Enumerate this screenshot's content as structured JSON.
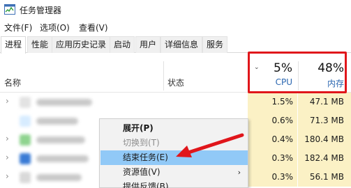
{
  "window": {
    "title": "任务管理器",
    "icon": "task-manager-icon"
  },
  "menu": [
    "文件(F)",
    "选项(O)",
    "查看(V)"
  ],
  "tabs": [
    {
      "label": "进程",
      "active": true
    },
    {
      "label": "性能",
      "active": false
    },
    {
      "label": "应用历史记录",
      "active": false
    },
    {
      "label": "启动",
      "active": false
    },
    {
      "label": "用户",
      "active": false
    },
    {
      "label": "详细信息",
      "active": false
    },
    {
      "label": "服务",
      "active": false
    }
  ],
  "columns": {
    "name": "名称",
    "status": "状态",
    "sort_icon": "chevron-down-icon",
    "cpu": {
      "percent": "5%",
      "label": "CPU"
    },
    "memory": {
      "percent": "48%",
      "label": "内存"
    }
  },
  "rows": [
    {
      "cpu": "1.5%",
      "memory": "47.1 MB",
      "expandable": true,
      "icon_color": "#e3e3e3"
    },
    {
      "cpu": "0.6%",
      "memory": "71.3 MB",
      "expandable": false,
      "icon_color": "#d7ecff"
    },
    {
      "cpu": "0.4%",
      "memory": "180.4 MB",
      "expandable": true,
      "icon_color": "#8fd48f"
    },
    {
      "cpu": "0.3%",
      "memory": "182.4 MB",
      "expandable": true,
      "icon_color": "#3a7bd5"
    },
    {
      "cpu": "0.3%",
      "memory": "56.1 MB",
      "expandable": true,
      "icon_color": "#d9d9d9"
    }
  ],
  "context_menu": [
    {
      "label": "展开(P)",
      "style": "bold"
    },
    {
      "label": "切换到(T)",
      "style": "disabled"
    },
    {
      "label": "结束任务(E)",
      "style": "highlight"
    },
    {
      "label": "资源值(V)",
      "style": "normal",
      "submenu": "›"
    },
    {
      "label": "提供反馈(B)",
      "style": "normal"
    }
  ],
  "colors": {
    "highlight_box": "#e0161b",
    "arrow": "#e0161b",
    "cell_bg": "#fbf1c5",
    "menu_highlight": "#91c9f7",
    "header_label": "#2a66b0"
  }
}
